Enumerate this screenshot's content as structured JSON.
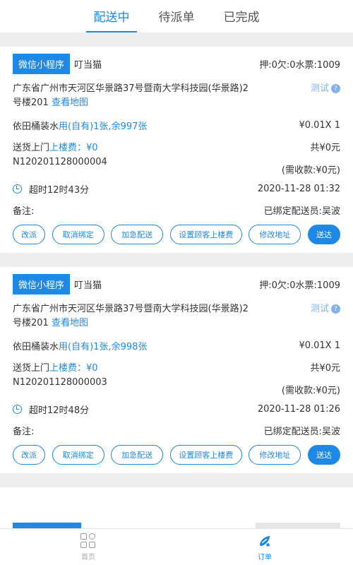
{
  "tabs": [
    {
      "label": "配送中",
      "active": true
    },
    {
      "label": "待派单",
      "active": false
    },
    {
      "label": "已完成",
      "active": false
    }
  ],
  "orders": [
    {
      "source_badge": "微信小程序",
      "shop": "叮当猫",
      "deposit_info": "押:0欠:0水票:1009",
      "address": "广东省广州市天河区华景路37号暨南大学科技园(华景路)2号楼201",
      "view_map": "查看地图",
      "test_label": "测试",
      "product": "依田桶装水",
      "product_link": "用(自有)1张,余997张",
      "price_qty": "¥0.01X 1",
      "delivery_label": "送货上门",
      "floor_fee": "上楼费：¥0",
      "total": "共¥0元",
      "order_no": "N120201128000004",
      "need_collect": "(需收款:¥0元)",
      "timeout": "超时12时43分",
      "time": "2020-11-28 01:32",
      "remark_label": "备注:",
      "assigned": "已绑定配送员:吴波"
    },
    {
      "source_badge": "微信小程序",
      "shop": "叮当猫",
      "deposit_info": "押:0欠:0水票:1009",
      "address": "广东省广州市天河区华景路37号暨南大学科技园(华景路)2号楼201",
      "view_map": "查看地图",
      "test_label": "测试",
      "product": "依田桶装水",
      "product_link": "用(自有)1张,余998张",
      "price_qty": "¥0.01X 1",
      "delivery_label": "送货上门",
      "floor_fee": "上楼费：¥0",
      "total": "共¥0元",
      "order_no": "N120201128000003",
      "need_collect": "(需收款:¥0元)",
      "timeout": "超时12时48分",
      "time": "2020-11-28 01:26",
      "remark_label": "备注:",
      "assigned": "已绑定配送员:吴波"
    }
  ],
  "buttons": {
    "reassign": "改派",
    "unbind": "取消绑定",
    "urgent": "加急配送",
    "set_fee": "设置顾客上楼费",
    "edit_addr": "修改地址",
    "deliver": "送达"
  },
  "bottom_nav": {
    "home": "首页",
    "orders": "订单"
  },
  "colors": {
    "accent": "#1e88e5",
    "background_gap": "#eeeeee"
  }
}
